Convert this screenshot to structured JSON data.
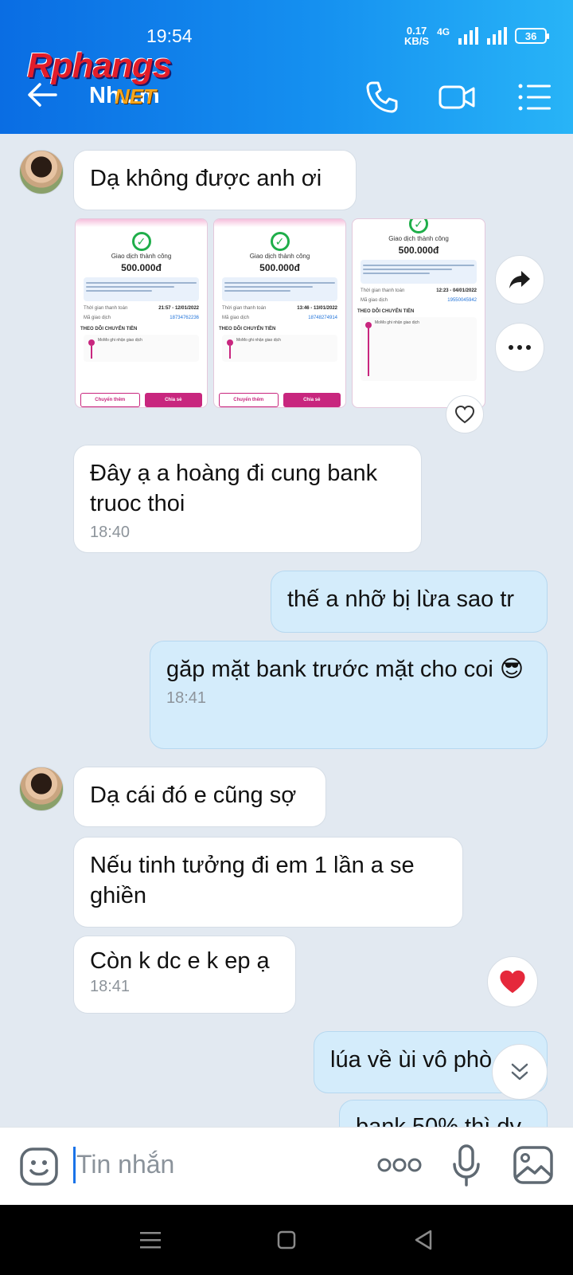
{
  "status_bar": {
    "time": "19:54",
    "net_speed_value": "0.17",
    "net_speed_unit": "KB/S",
    "network": "4G",
    "battery": "36"
  },
  "watermark": {
    "line1": "Rphangs",
    "line2": "NET"
  },
  "header": {
    "contact_name": "Nh...m"
  },
  "messages": {
    "m1": {
      "text": "Dạ không được anh ơi"
    },
    "m2": {
      "text": "Đây ạ a hoàng đi cung bank truoc thoi",
      "time": "18:40"
    },
    "m3": {
      "text": "thế a nhỡ bị lừa sao tr"
    },
    "m4": {
      "text": "găp mặt bank trước mặt cho coi 😎",
      "time": "18:41"
    },
    "m5": {
      "text": "Dạ cái đó e cũng sợ"
    },
    "m6": {
      "text": "Nếu tinh tưởng đi em 1 lần a se ghiền"
    },
    "m7": {
      "text": "Còn k dc e k ep ạ",
      "time": "18:41"
    },
    "m8": {
      "text": "lúa về ùi vô phò"
    },
    "m9": {
      "text": "bank 50% thì dv"
    }
  },
  "screenshots": [
    {
      "title": "Giao dịch thành công",
      "amount": "500.000đ",
      "time_label": "Thời gian thanh toán",
      "time_value": "21:57 - 12/01/2022",
      "code_label": "Mã giao dịch",
      "code_value": "18734762236",
      "section": "THEO DÕI CHUYỂN TIỀN",
      "step": "MoMo ghi nhận giao dịch",
      "btn1": "Chuyển thêm",
      "btn2": "Chia sẻ"
    },
    {
      "title": "Giao dịch thành công",
      "amount": "500.000đ",
      "time_label": "Thời gian thanh toán",
      "time_value": "13:46 - 13/01/2022",
      "code_label": "Mã giao dịch",
      "code_value": "18748274914",
      "section": "THEO DÕI CHUYỂN TIỀN",
      "step": "MoMo ghi nhận giao dịch",
      "btn1": "Chuyển thêm",
      "btn2": "Chia sẻ"
    },
    {
      "title": "Giao dịch thành công",
      "amount": "500.000đ",
      "time_label": "Thời gian thanh toán",
      "time_value": "12:23 - 04/01/2022",
      "code_label": "Mã giao dịch",
      "code_value": "19550045942",
      "section": "THEO DÕI CHUYỂN TIỀN",
      "step": "MoMo ghi nhận giao dịch"
    }
  ],
  "input": {
    "placeholder": "Tin nhắn"
  },
  "colors": {
    "header_start": "#0a6de3",
    "header_end": "#28b4f7",
    "outgoing": "#d4ecfb",
    "incoming": "#ffffff",
    "accent_pink": "#c8267e"
  }
}
